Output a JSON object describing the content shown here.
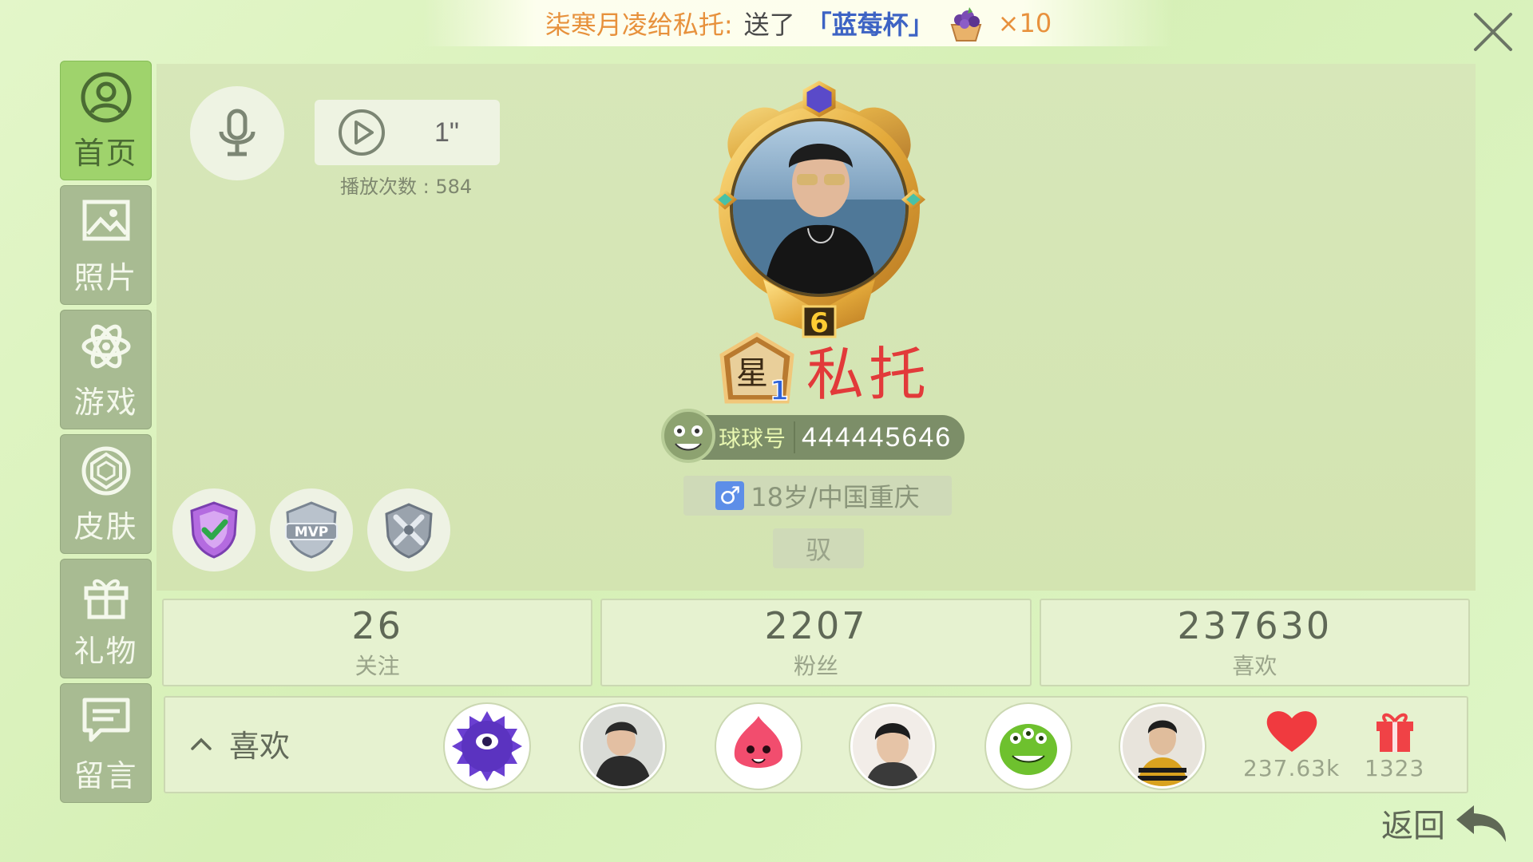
{
  "banner": {
    "from": "柒寒月凌给私托:",
    "action": "送了",
    "gift": "「蓝莓杯」",
    "count": "×10"
  },
  "nav": {
    "items": [
      {
        "label": "首页",
        "icon": "profile-icon",
        "active": true
      },
      {
        "label": "照片",
        "icon": "photo-icon",
        "active": false
      },
      {
        "label": "游戏",
        "icon": "atom-icon",
        "active": false
      },
      {
        "label": "皮肤",
        "icon": "gem-icon",
        "active": false
      },
      {
        "label": "礼物",
        "icon": "gift-icon",
        "active": false
      },
      {
        "label": "留言",
        "icon": "message-icon",
        "active": false
      }
    ]
  },
  "profile": {
    "voice_duration": "1\"",
    "play_count": "播放次数 : 584",
    "level": "6",
    "rank": "星",
    "rank_num": "1",
    "username": "私托",
    "id_label": "球球号",
    "id_number": "444445646",
    "gender_symbol": "♂",
    "info": "18岁/中国重庆",
    "signature": "驭"
  },
  "stats": [
    {
      "value": "26",
      "label": "关注"
    },
    {
      "value": "2207",
      "label": "粉丝"
    },
    {
      "value": "237630",
      "label": "喜欢"
    }
  ],
  "likes": {
    "toggle_label": "喜欢",
    "likes_total": "237.63k",
    "gifts_total": "1323"
  },
  "footer": {
    "back_label": "返回"
  },
  "colors": {
    "accent_green": "#9fd36c",
    "username_red": "#e23a3a",
    "banner_orange": "#e7913c",
    "banner_blue": "#3d63c4"
  }
}
